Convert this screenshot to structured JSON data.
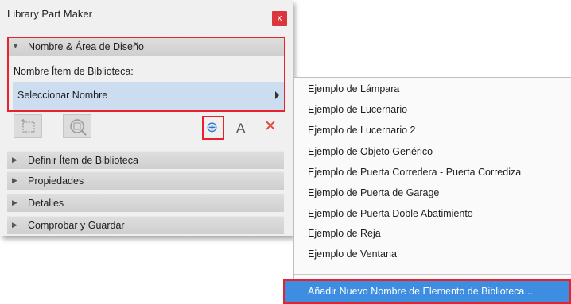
{
  "window": {
    "title": "Library Part Maker",
    "close_glyph": "x"
  },
  "sections": {
    "nombre_area": "Nombre & Área de Diseño",
    "definir": "Definir Ítem de Biblioteca",
    "propiedades": "Propiedades",
    "detalles": "Detalles",
    "comprobar": "Comprobar y Guardar"
  },
  "name_field": {
    "label": "Nombre Ítem de Biblioteca:",
    "value": "Seleccionar Nombre"
  },
  "toolbar": {
    "add_glyph": "⊕",
    "text_glyph": "A",
    "text_cursor_glyph": "I",
    "delete_glyph": "✕"
  },
  "menu": {
    "items": [
      "Ejemplo de Lámpara",
      "Ejemplo de Lucernario",
      "Ejemplo de Lucernario 2",
      "Ejemplo de Objeto Genérico",
      "Ejemplo de Puerta Corredera - Puerta Corrediza",
      "Ejemplo de Puerta de Garage",
      "Ejemplo de Puerta Doble Abatimiento",
      "Ejemplo de Reja",
      "Ejemplo de Ventana"
    ],
    "add_new": "Añadir Nuevo Nombre de Elemento de Biblioteca..."
  },
  "colors": {
    "accent_red": "#e8222d",
    "selection_blue": "#3d8ee0",
    "field_blue": "#ccddf0"
  }
}
